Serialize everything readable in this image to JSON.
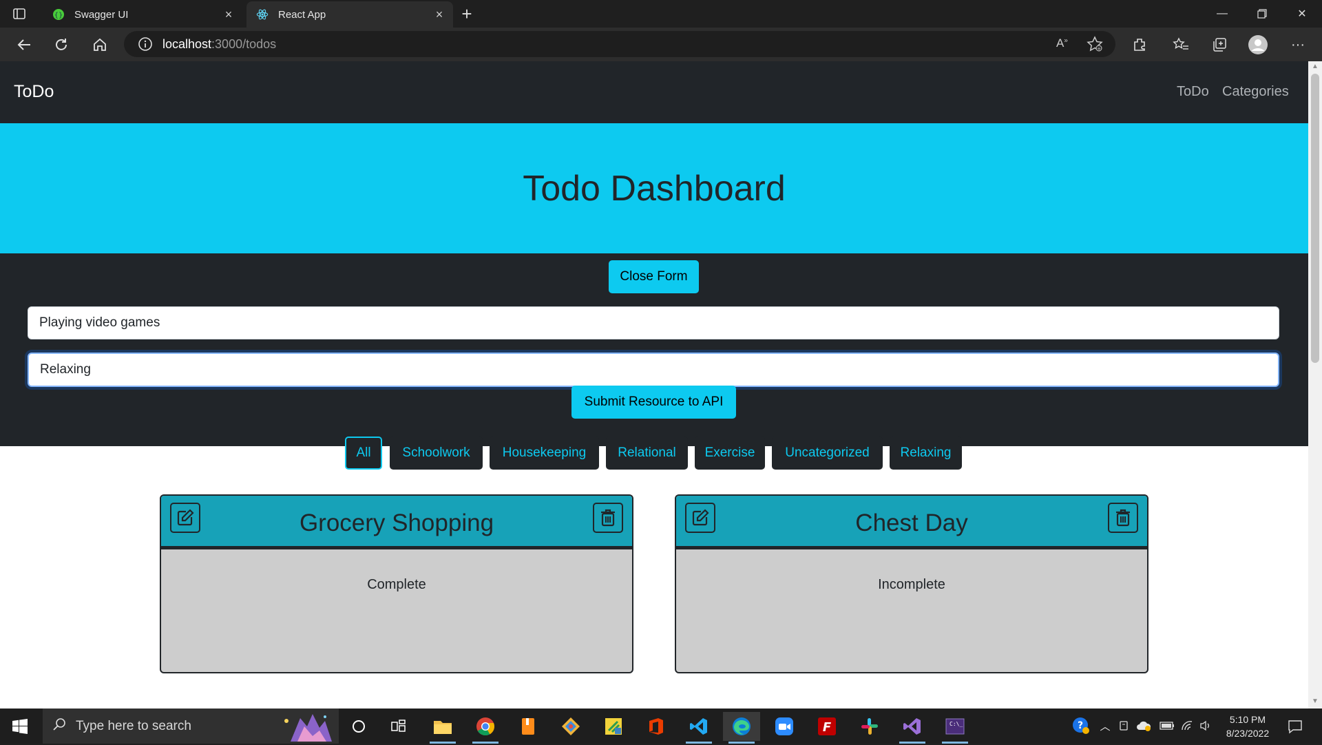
{
  "browser": {
    "tabs": [
      {
        "title": "Swagger UI",
        "icon": "swagger-icon"
      },
      {
        "title": "React App",
        "icon": "react-icon"
      }
    ],
    "url_host": "localhost",
    "url_path": ":3000/todos"
  },
  "navbar": {
    "brand": "ToDo",
    "links": [
      "ToDo",
      "Categories"
    ]
  },
  "hero": {
    "title": "Todo Dashboard"
  },
  "form": {
    "toggle_label": "Close Form",
    "title_value": "Playing video games",
    "category_value": "Relaxing",
    "submit_label": "Submit Resource to API"
  },
  "categories": [
    "All",
    "Schoolwork",
    "Housekeeping",
    "Relational",
    "Exercise",
    "Uncategorized",
    "Relaxing"
  ],
  "active_category": "All",
  "todos": [
    {
      "title": "Grocery Shopping",
      "status": "Complete"
    },
    {
      "title": "Chest Day",
      "status": "Incomplete"
    }
  ],
  "taskbar": {
    "search_placeholder": "Type here to search",
    "time": "5:10 PM",
    "date": "8/23/2022"
  },
  "colors": {
    "accent": "#0dcaf0",
    "card_header": "#17a2b8",
    "dark": "#212529",
    "card_body": "#cdcdcd"
  }
}
